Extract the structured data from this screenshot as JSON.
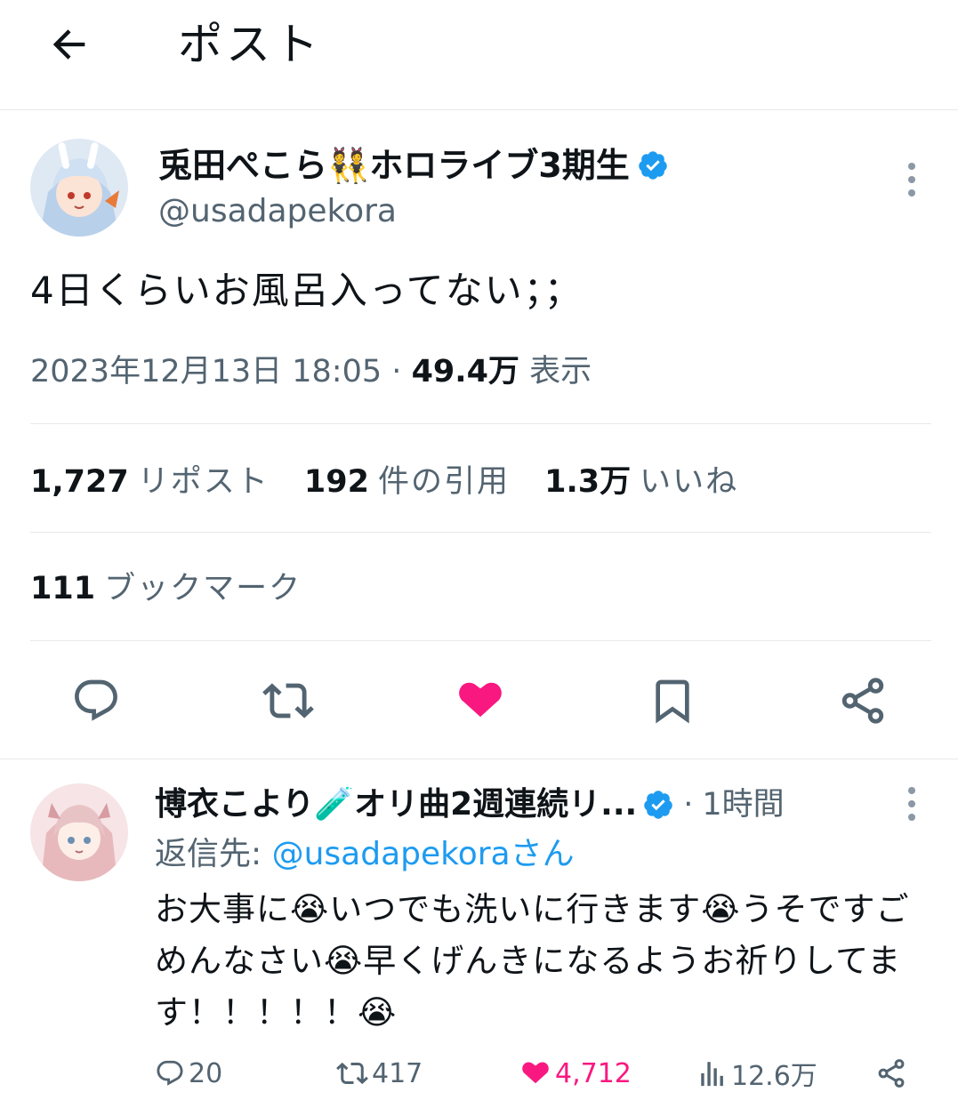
{
  "header": {
    "title": "ポスト"
  },
  "tweet": {
    "author": {
      "display_name": "兎田ぺこら👯ホロライブ3期生",
      "handle": "@usadapekora"
    },
    "text": "4日くらいお風呂入ってない；；",
    "timestamp": "2023年12月13日 18:05",
    "separator": "·",
    "views_value": "49.4万",
    "views_label": "表示",
    "stats": {
      "reposts": {
        "value": "1,727",
        "label": "リポスト"
      },
      "quotes": {
        "value": "192",
        "label": "件の引用"
      },
      "likes": {
        "value": "1.3万",
        "label": "いいね"
      },
      "bookmarks": {
        "value": "111",
        "label": "ブックマーク"
      }
    },
    "liked": true
  },
  "reply": {
    "author": {
      "display_name": "博衣こより🧪オリ曲2週連続リ...",
      "time_sep": "·",
      "time": "1時間"
    },
    "reply_to_prefix": "返信先: ",
    "reply_to_handle": "@usadapekora",
    "reply_to_suffix": "さん",
    "text": "お大事に😭いつでも洗いに行きます😭うそですごめんなさい😭早くげんきになるようお祈りしてます！！！！！😭",
    "actions": {
      "replies": "20",
      "reposts": "417",
      "likes": "4,712",
      "views": "12.6万"
    }
  },
  "colors": {
    "accent": "#1d9bf0",
    "like": "#f91880",
    "muted": "#536471",
    "text": "#0f1419"
  },
  "icons": [
    "back-arrow-icon",
    "verified-badge-icon",
    "more-vertical-icon",
    "reply-icon",
    "repost-icon",
    "heart-icon",
    "bookmark-icon",
    "share-icon",
    "views-icon"
  ]
}
